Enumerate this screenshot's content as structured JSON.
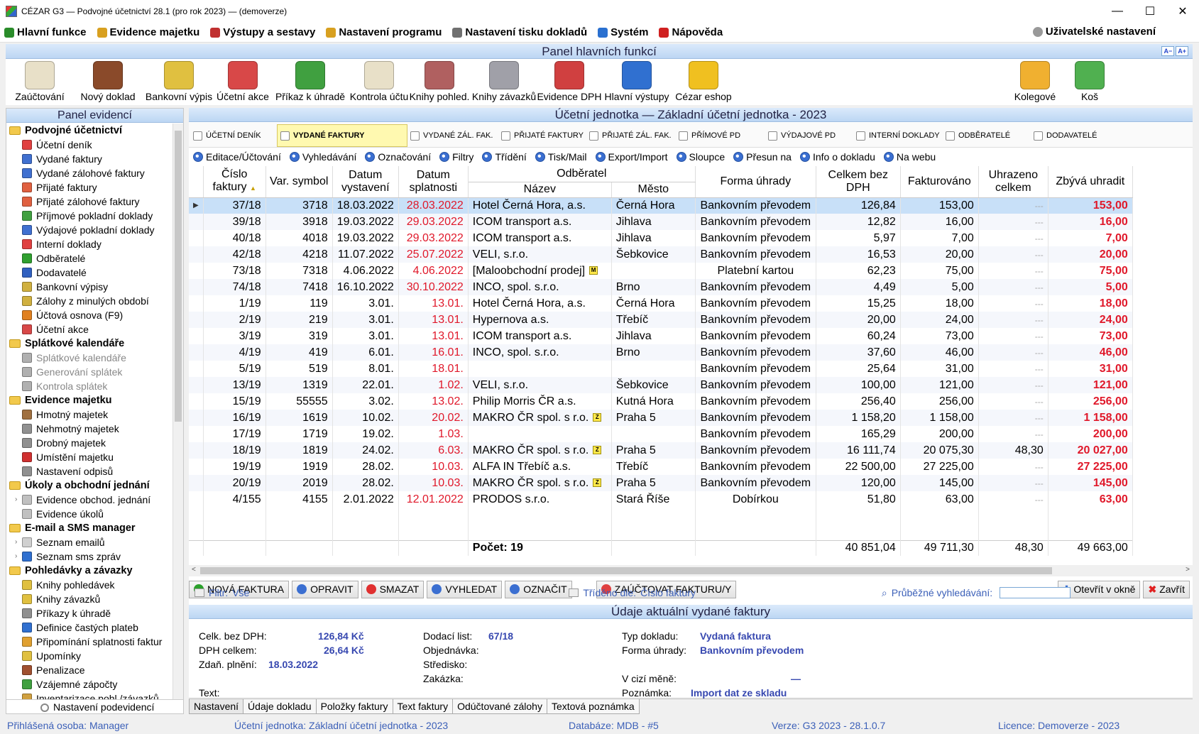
{
  "window": {
    "title": "CÉZAR G3 — Podvojné účetnictví 28.1  (pro rok 2023) — (demoverze)"
  },
  "menu": {
    "items": [
      {
        "label": "Hlavní funkce",
        "color": "#2a8c2a"
      },
      {
        "label": "Evidence majetku",
        "color": "#d8a020"
      },
      {
        "label": "Výstupy a sestavy",
        "color": "#c03030"
      },
      {
        "label": "Nastavení programu",
        "color": "#d8a020"
      },
      {
        "label": "Nastavení tisku dokladů",
        "color": "#707070"
      },
      {
        "label": "Systém",
        "color": "#2a70d0"
      },
      {
        "label": "Nápověda",
        "color": "#d02020"
      }
    ],
    "user_settings": "Uživatelské nastavení"
  },
  "toolbar": {
    "title": "Panel hlavních funkcí",
    "size_small": "A−",
    "size_large": "A+",
    "buttons": [
      {
        "label": "Zaúčtování",
        "color": "#e8e0c8"
      },
      {
        "label": "Nový doklad",
        "color": "#8a4a2a"
      },
      {
        "label": "Bankovní výpis",
        "color": "#e0c040"
      },
      {
        "label": "Účetní akce",
        "color": "#d84848"
      },
      {
        "label": "Příkaz k úhradě",
        "color": "#40a040"
      },
      {
        "label": "Kontrola účtu",
        "color": "#e8e0c8"
      },
      {
        "label": "Knihy pohled.",
        "color": "#b06060"
      },
      {
        "label": "Knihy závazků",
        "color": "#a0a0a8"
      },
      {
        "label": "Evidence DPH",
        "color": "#d04040"
      },
      {
        "label": "Hlavní výstupy",
        "color": "#3070d0"
      },
      {
        "label": "Cézar eshop",
        "color": "#f0c020"
      }
    ],
    "right_buttons": [
      {
        "label": "Kolegové",
        "color": "#f0b030"
      },
      {
        "label": "Koš",
        "color": "#50b050"
      }
    ]
  },
  "left_panel": {
    "title": "Panel evidencí",
    "settings": "Nastavení podevidencí",
    "tree": [
      {
        "type": "g",
        "label": "Podvojné účetnictví"
      },
      {
        "type": "i",
        "label": "Účetní deník",
        "color": "#e04040"
      },
      {
        "type": "i",
        "label": "Vydané faktury",
        "color": "#4070d0"
      },
      {
        "type": "i",
        "label": "Vydané zálohové faktury",
        "color": "#4070d0"
      },
      {
        "type": "i",
        "label": "Přijaté faktury",
        "color": "#e06040"
      },
      {
        "type": "i",
        "label": "Přijaté zálohové faktury",
        "color": "#e06040"
      },
      {
        "type": "i",
        "label": "Příjmové pokladní doklady",
        "color": "#40a040"
      },
      {
        "type": "i",
        "label": "Výdajové pokladní doklady",
        "color": "#4070d0"
      },
      {
        "type": "i",
        "label": "Interní doklady",
        "color": "#e04040"
      },
      {
        "type": "i",
        "label": "Odběratelé",
        "color": "#30a030"
      },
      {
        "type": "i",
        "label": "Dodavatelé",
        "color": "#3060c0"
      },
      {
        "type": "i",
        "label": "Bankovní výpisy",
        "color": "#d0b040"
      },
      {
        "type": "i",
        "label": "Zálohy z minulých období",
        "color": "#d0b040"
      },
      {
        "type": "i",
        "label": "Účtová osnova (F9)",
        "color": "#e08020"
      },
      {
        "type": "i",
        "label": "Účetní akce",
        "color": "#d84848"
      },
      {
        "type": "g",
        "label": "Splátkové kalendáře"
      },
      {
        "type": "i",
        "label": "Splátkové kalendáře",
        "color": "#b0b0b0",
        "dim": true
      },
      {
        "type": "i",
        "label": "Generování splátek",
        "color": "#b0b0b0",
        "dim": true
      },
      {
        "type": "i",
        "label": "Kontrola splátek",
        "color": "#b0b0b0",
        "dim": true
      },
      {
        "type": "g",
        "label": "Evidence majetku"
      },
      {
        "type": "i",
        "label": "Hmotný majetek",
        "color": "#a07040"
      },
      {
        "type": "i",
        "label": "Nehmotný majetek",
        "color": "#909090"
      },
      {
        "type": "i",
        "label": "Drobný majetek",
        "color": "#909090"
      },
      {
        "type": "i",
        "label": "Umístění majetku",
        "color": "#d03030"
      },
      {
        "type": "i",
        "label": "Nastavení odpisů",
        "color": "#909090"
      },
      {
        "type": "g",
        "label": "Úkoly a obchodní jednání"
      },
      {
        "type": "i",
        "label": "Evidence obchod. jednání",
        "color": "#c0c0c0",
        "arrow": true
      },
      {
        "type": "i",
        "label": "Evidence úkolů",
        "color": "#c0c0c0"
      },
      {
        "type": "g",
        "label": "E-mail a SMS manager"
      },
      {
        "type": "i",
        "label": "Seznam emailů",
        "color": "#d0d0d0",
        "arrow": true
      },
      {
        "type": "i",
        "label": "Seznam sms zpráv",
        "color": "#3070d0",
        "arrow": true
      },
      {
        "type": "g",
        "label": "Pohledávky a závazky"
      },
      {
        "type": "i",
        "label": "Knihy pohledávek",
        "color": "#e0c040"
      },
      {
        "type": "i",
        "label": "Knihy závazků",
        "color": "#e0c040"
      },
      {
        "type": "i",
        "label": "Příkazy k úhradě",
        "color": "#909090"
      },
      {
        "type": "i",
        "label": "Definice častých plateb",
        "color": "#3070d0"
      },
      {
        "type": "i",
        "label": "Připomínání splatnosti faktur",
        "color": "#e0a030"
      },
      {
        "type": "i",
        "label": "Upomínky",
        "color": "#e0c040"
      },
      {
        "type": "i",
        "label": "Penalizace",
        "color": "#a05030"
      },
      {
        "type": "i",
        "label": "Vzájemné zápočty",
        "color": "#40a040"
      },
      {
        "type": "i",
        "label": "Inventarizace pohl./závazků",
        "color": "#d0a040"
      }
    ]
  },
  "main": {
    "title": "Účetní jednotka — Základní účetní jednotka - 2023",
    "tabs": [
      {
        "label": "ÚČETNÍ DENÍK",
        "active": false
      },
      {
        "label": "VYDANÉ FAKTURY",
        "active": true
      },
      {
        "label": "VYDANÉ ZÁL. FAK.",
        "active": false
      },
      {
        "label": "PŘIJATÉ FAKTURY",
        "active": false
      },
      {
        "label": "PŘIJATÉ ZÁL. FAK.",
        "active": false
      },
      {
        "label": "PŘÍMOVÉ PD",
        "active": false
      },
      {
        "label": "VÝDAJOVÉ PD",
        "active": false
      },
      {
        "label": "INTERNÍ DOKLADY",
        "active": false
      },
      {
        "label": "ODBĚRATELÉ",
        "active": false
      },
      {
        "label": "DODAVATELÉ",
        "active": false
      }
    ],
    "actions": [
      "Editace/Účtování",
      "Vyhledávání",
      "Označování",
      "Filtry",
      "Třídění",
      "Tisk/Mail",
      "Export/Import",
      "Sloupce",
      "Přesun na",
      "Info o dokladu",
      "Na webu"
    ],
    "columns": {
      "cislo": "Číslo faktury",
      "var": "Var. symbol",
      "vystaveni": "Datum vystavení",
      "splatnosti": "Datum splatnosti",
      "odberatel": "Odběratel",
      "nazev": "Název",
      "mesto": "Město",
      "forma": "Forma úhrady",
      "bezdph": "Celkem bez DPH",
      "fakturovano": "Fakturováno",
      "uhrazeno": "Uhrazeno celkem",
      "zbyva": "Zbývá uhradit"
    },
    "rows": [
      {
        "cislo": "37/18",
        "var": "3718",
        "vyst": "18.03.2022",
        "splat": "28.03.2022",
        "nazev": "Hotel Černá Hora, a.s.",
        "badge": "",
        "mesto": "Černá Hora",
        "forma": "Bankovním převodem",
        "bezdph": "126,84",
        "fakt": "153,00",
        "uhr": "---",
        "zbyva": "153,00"
      },
      {
        "cislo": "39/18",
        "var": "3918",
        "vyst": "19.03.2022",
        "splat": "29.03.2022",
        "nazev": "ICOM transport a.s.",
        "badge": "",
        "mesto": "Jihlava",
        "forma": "Bankovním převodem",
        "bezdph": "12,82",
        "fakt": "16,00",
        "uhr": "---",
        "zbyva": "16,00"
      },
      {
        "cislo": "40/18",
        "var": "4018",
        "vyst": "19.03.2022",
        "splat": "29.03.2022",
        "nazev": "ICOM transport a.s.",
        "badge": "",
        "mesto": "Jihlava",
        "forma": "Bankovním převodem",
        "bezdph": "5,97",
        "fakt": "7,00",
        "uhr": "---",
        "zbyva": "7,00"
      },
      {
        "cislo": "42/18",
        "var": "4218",
        "vyst": "11.07.2022",
        "splat": "25.07.2022",
        "nazev": "VELI, s.r.o.",
        "badge": "",
        "mesto": "Šebkovice",
        "forma": "Bankovním převodem",
        "bezdph": "16,53",
        "fakt": "20,00",
        "uhr": "---",
        "zbyva": "20,00"
      },
      {
        "cislo": "73/18",
        "var": "7318",
        "vyst": "4.06.2022",
        "splat": "4.06.2022",
        "nazev": "[Maloobchodní prodej]",
        "badge": "M",
        "mesto": "",
        "forma": "Platební kartou",
        "bezdph": "62,23",
        "fakt": "75,00",
        "uhr": "---",
        "zbyva": "75,00"
      },
      {
        "cislo": "74/18",
        "var": "7418",
        "vyst": "16.10.2022",
        "splat": "30.10.2022",
        "nazev": "INCO, spol. s.r.o.",
        "badge": "",
        "mesto": "Brno",
        "forma": "Bankovním převodem",
        "bezdph": "4,49",
        "fakt": "5,00",
        "uhr": "---",
        "zbyva": "5,00"
      },
      {
        "cislo": "1/19",
        "var": "119",
        "vyst": "3.01.",
        "splat": "13.01.",
        "nazev": "Hotel Černá Hora, a.s.",
        "badge": "",
        "mesto": "Černá Hora",
        "forma": "Bankovním převodem",
        "bezdph": "15,25",
        "fakt": "18,00",
        "uhr": "---",
        "zbyva": "18,00"
      },
      {
        "cislo": "2/19",
        "var": "219",
        "vyst": "3.01.",
        "splat": "13.01.",
        "nazev": "Hypernova a.s.",
        "badge": "",
        "mesto": "Třebíč",
        "forma": "Bankovním převodem",
        "bezdph": "20,00",
        "fakt": "24,00",
        "uhr": "---",
        "zbyva": "24,00"
      },
      {
        "cislo": "3/19",
        "var": "319",
        "vyst": "3.01.",
        "splat": "13.01.",
        "nazev": "ICOM transport a.s.",
        "badge": "",
        "mesto": "Jihlava",
        "forma": "Bankovním převodem",
        "bezdph": "60,24",
        "fakt": "73,00",
        "uhr": "---",
        "zbyva": "73,00"
      },
      {
        "cislo": "4/19",
        "var": "419",
        "vyst": "6.01.",
        "splat": "16.01.",
        "nazev": "INCO, spol. s.r.o.",
        "badge": "",
        "mesto": "Brno",
        "forma": "Bankovním převodem",
        "bezdph": "37,60",
        "fakt": "46,00",
        "uhr": "---",
        "zbyva": "46,00"
      },
      {
        "cislo": "5/19",
        "var": "519",
        "vyst": "8.01.",
        "splat": "18.01.",
        "nazev": "",
        "badge": "",
        "mesto": "",
        "forma": "Bankovním převodem",
        "bezdph": "25,64",
        "fakt": "31,00",
        "uhr": "---",
        "zbyva": "31,00"
      },
      {
        "cislo": "13/19",
        "var": "1319",
        "vyst": "22.01.",
        "splat": "1.02.",
        "nazev": "VELI, s.r.o.",
        "badge": "",
        "mesto": "Šebkovice",
        "forma": "Bankovním převodem",
        "bezdph": "100,00",
        "fakt": "121,00",
        "uhr": "---",
        "zbyva": "121,00"
      },
      {
        "cislo": "15/19",
        "var": "55555",
        "vyst": "3.02.",
        "splat": "13.02.",
        "nazev": "Philip Morris ČR a.s.",
        "badge": "",
        "mesto": "Kutná Hora",
        "forma": "Bankovním převodem",
        "bezdph": "256,40",
        "fakt": "256,00",
        "uhr": "---",
        "zbyva": "256,00"
      },
      {
        "cislo": "16/19",
        "var": "1619",
        "vyst": "10.02.",
        "splat": "20.02.",
        "nazev": "MAKRO ČR spol. s r.o.",
        "badge": "Z",
        "mesto": "Praha 5",
        "forma": "Bankovním převodem",
        "bezdph": "1 158,20",
        "fakt": "1 158,00",
        "uhr": "---",
        "zbyva": "1 158,00"
      },
      {
        "cislo": "17/19",
        "var": "1719",
        "vyst": "19.02.",
        "splat": "1.03.",
        "nazev": "",
        "badge": "",
        "mesto": "",
        "forma": "Bankovním převodem",
        "bezdph": "165,29",
        "fakt": "200,00",
        "uhr": "---",
        "zbyva": "200,00"
      },
      {
        "cislo": "18/19",
        "var": "1819",
        "vyst": "24.02.",
        "splat": "6.03.",
        "nazev": "MAKRO ČR spol. s r.o.",
        "badge": "Z",
        "mesto": "Praha 5",
        "forma": "Bankovním převodem",
        "bezdph": "16 111,74",
        "fakt": "20 075,30",
        "uhr": "48,30",
        "zbyva": "20 027,00"
      },
      {
        "cislo": "19/19",
        "var": "1919",
        "vyst": "28.02.",
        "splat": "10.03.",
        "nazev": "ALFA IN Třebíč a.s.",
        "badge": "",
        "mesto": "Třebíč",
        "forma": "Bankovním převodem",
        "bezdph": "22 500,00",
        "fakt": "27 225,00",
        "uhr": "---",
        "zbyva": "27 225,00"
      },
      {
        "cislo": "20/19",
        "var": "2019",
        "vyst": "28.02.",
        "splat": "10.03.",
        "nazev": "MAKRO ČR spol. s r.o.",
        "badge": "Z",
        "mesto": "Praha 5",
        "forma": "Bankovním převodem",
        "bezdph": "120,00",
        "fakt": "145,00",
        "uhr": "---",
        "zbyva": "145,00"
      },
      {
        "cislo": "4/155",
        "var": "4155",
        "vyst": "2.01.2022",
        "splat": "12.01.2022",
        "nazev": "PRODOS s.r.o.",
        "badge": "",
        "mesto": "Stará Říše",
        "forma": "Dobírkou",
        "bezdph": "51,80",
        "fakt": "63,00",
        "uhr": "---",
        "zbyva": "63,00"
      }
    ],
    "summary": {
      "count": "Počet: 19",
      "bezdph": "40 851,04",
      "fakt": "49 711,30",
      "uhr": "48,30",
      "zbyva": "49 663,00"
    },
    "buttons": {
      "new": "NOVÁ FAKTURA",
      "edit": "OPRAVIT",
      "delete": "SMAZAT",
      "search": "VYHLEDAT",
      "mark": "OZNAČIT",
      "post": "ZAÚČTOVAT FAKTURU/Y",
      "open": "Otevřít v okně",
      "close": "Zavřít"
    },
    "filter": {
      "label": "Filtr:",
      "value": "Vše",
      "sort_label": "Tříděno dle:",
      "sort_value": "Číslo faktury",
      "search_label": "Průběžné vyhledávání:",
      "search_value": ""
    }
  },
  "detail": {
    "title": "Údaje aktuální vydané faktury",
    "celk_label": "Celk. bez DPH:",
    "celk_value": "126,84 Kč",
    "dph_label": "DPH celkem:",
    "dph_value": "26,64 Kč",
    "zdan_label": "Zdaň. plnění:",
    "zdan_value": "18.03.2022",
    "text_label": "Text:",
    "dodaci_label": "Dodací list:",
    "dodaci_value": "67/18",
    "objednavka_label": "Objednávka:",
    "stredisko_label": "Středisko:",
    "zakazka_label": "Zakázka:",
    "typ_label": "Typ dokladu:",
    "typ_value": "Vydaná faktura",
    "forma_label": "Forma úhrady:",
    "forma_value": "Bankovním převodem",
    "cizi_label": "V cizí měně:",
    "cizi_value": "—",
    "poznamka_label": "Poznámka:",
    "poznamka_value": "Import dat ze skladu"
  },
  "bottom_tabs": [
    "Nastavení",
    "Údaje dokladu",
    "Položky faktury",
    "Text faktury",
    "Odúčtované zálohy",
    "Textová poznámka"
  ],
  "status": {
    "user": "Přihlášená osoba:  Manager",
    "unit": "Účetní jednotka:  Základní účetní jednotka - 2023",
    "db": "Databáze:  MDB - #5",
    "version": "Verze:  G3 2023 - 28.1.0.7",
    "licence": "Licence:  Demoverze - 2023"
  }
}
